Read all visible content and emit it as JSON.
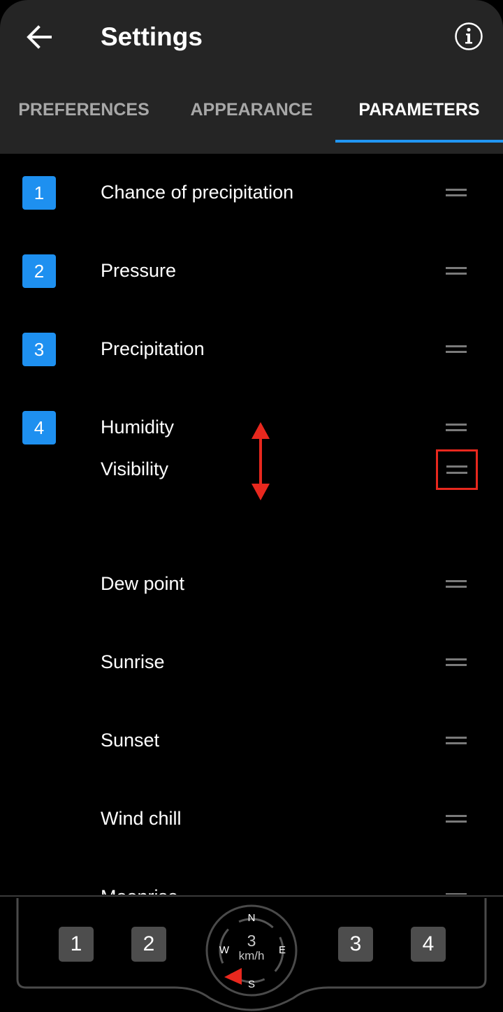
{
  "header": {
    "title": "Settings",
    "back_icon": "arrow-left-icon",
    "info_icon": "info-icon"
  },
  "tabs": [
    {
      "label": "PREFERENCES",
      "active": false
    },
    {
      "label": "APPEARANCE",
      "active": false
    },
    {
      "label": "PARAMETERS",
      "active": true
    }
  ],
  "parameters": [
    {
      "slot": "1",
      "label": "Chance of precipitation"
    },
    {
      "slot": "2",
      "label": "Pressure"
    },
    {
      "slot": "3",
      "label": "Precipitation"
    },
    {
      "slot": "4",
      "label": "Humidity"
    },
    {
      "slot": "",
      "label": "Dew point"
    },
    {
      "slot": "",
      "label": "Sunrise"
    },
    {
      "slot": "",
      "label": "Sunset"
    },
    {
      "slot": "",
      "label": "Wind chill"
    },
    {
      "slot": "",
      "label": "Moonrise"
    }
  ],
  "dragging": {
    "label": "Visibility",
    "highlight_color": "#e8281e"
  },
  "colors": {
    "accent": "#2196f3",
    "badge": "#1e90f0",
    "header_bg": "#252525",
    "drag_indicator": "#e8281e"
  },
  "preview": {
    "slots": [
      "1",
      "2",
      "3",
      "4"
    ],
    "compass": {
      "north": "N",
      "south": "S",
      "east": "E",
      "west": "W",
      "speed": "3",
      "unit": "km/h"
    }
  }
}
